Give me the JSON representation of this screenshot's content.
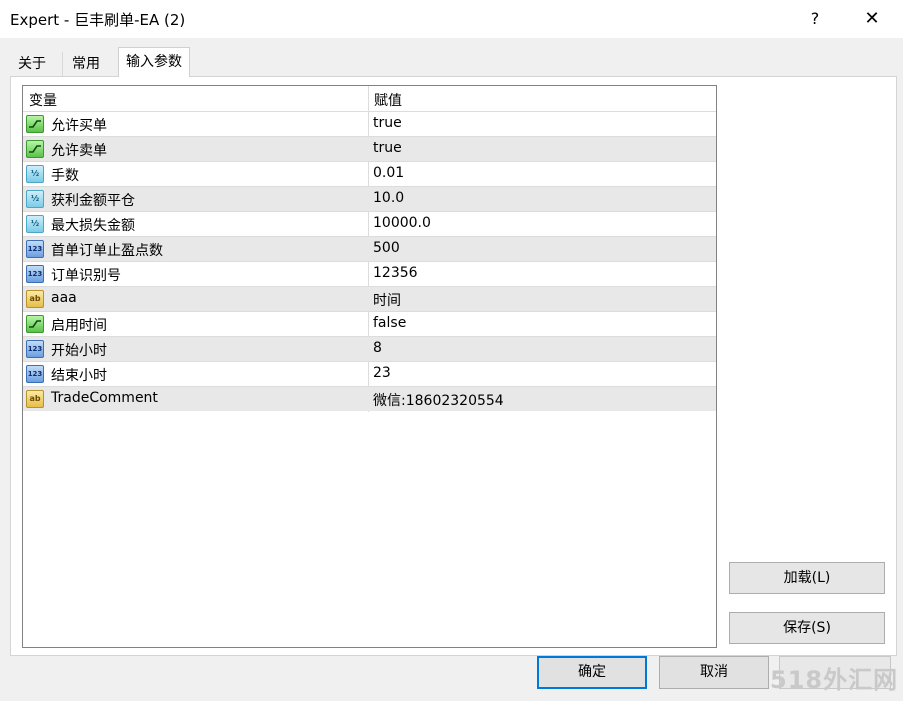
{
  "window": {
    "title": "Expert - 巨丰刷单-EA (2)",
    "help": "?",
    "close": "✕"
  },
  "tabs": [
    {
      "label": "关于"
    },
    {
      "label": "常用"
    },
    {
      "label": "输入参数"
    }
  ],
  "grid": {
    "headers": {
      "variable": "变量",
      "value": "赋值"
    },
    "rows": [
      {
        "type": "bool",
        "name": "允许买单",
        "value": "true"
      },
      {
        "type": "bool",
        "name": "允许卖单",
        "value": "true"
      },
      {
        "type": "double",
        "name": "手数",
        "value": "0.01"
      },
      {
        "type": "double",
        "name": "获利金额平仓",
        "value": "10.0"
      },
      {
        "type": "double",
        "name": "最大损失金额",
        "value": "10000.0"
      },
      {
        "type": "int",
        "name": "首单订单止盈点数",
        "value": "500"
      },
      {
        "type": "int",
        "name": "订单识别号",
        "value": "12356"
      },
      {
        "type": "string",
        "name": "aaa",
        "value": "时间"
      },
      {
        "type": "bool",
        "name": "启用时间",
        "value": "false"
      },
      {
        "type": "int",
        "name": "开始小时",
        "value": "8"
      },
      {
        "type": "int",
        "name": "结束小时",
        "value": "23"
      },
      {
        "type": "string",
        "name": "TradeComment",
        "value": "微信:18602320554"
      }
    ]
  },
  "icons": {
    "bool": "toggle-icon",
    "double": "fraction-icon",
    "int": "integer-icon",
    "string": "text-icon",
    "labels": {
      "double": "½",
      "int": "123",
      "string": "ab"
    }
  },
  "buttons": {
    "load": "加载(L)",
    "save": "保存(S)",
    "ok": "确定",
    "cancel": "取消"
  },
  "watermark": "518外汇网",
  "colors": {
    "accent": "#0078d7",
    "row_alt": "#e8e8e8"
  }
}
